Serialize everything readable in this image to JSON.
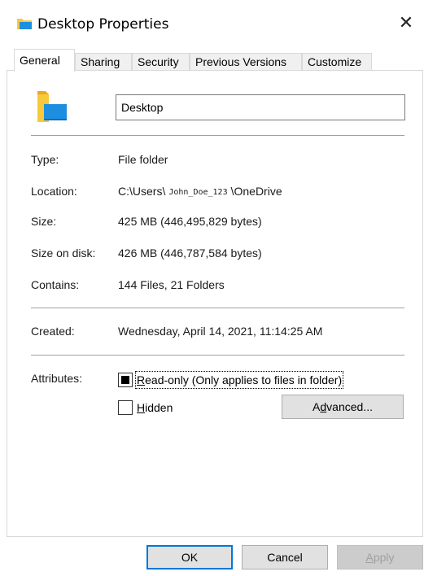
{
  "window": {
    "title": "Desktop Properties",
    "close_glyph": "✕"
  },
  "tabs": [
    {
      "label": "General",
      "active": true
    },
    {
      "label": "Sharing",
      "active": false
    },
    {
      "label": "Security",
      "active": false
    },
    {
      "label": "Previous Versions",
      "active": false
    },
    {
      "label": "Customize",
      "active": false
    }
  ],
  "general": {
    "folder_name": "Desktop",
    "type_label": "Type:",
    "type_value": "File folder",
    "location_label": "Location:",
    "location_prefix": "C:\\Users\\",
    "location_user": "John_Doe_123",
    "location_suffix": "\\OneDrive",
    "size_label": "Size:",
    "size_value": "425 MB (446,495,829 bytes)",
    "size_on_disk_label": "Size on disk:",
    "size_on_disk_value": "426 MB (446,787,584 bytes)",
    "contains_label": "Contains:",
    "contains_value": "144 Files, 21 Folders",
    "created_label": "Created:",
    "created_value": "Wednesday, April 14, 2021, 11:14:25 AM",
    "attributes_label": "Attributes:",
    "readonly_label_first": "R",
    "readonly_label_rest": "ead-only (Only applies to files in folder)",
    "readonly_state": "indeterminate",
    "hidden_label_first": "H",
    "hidden_label_rest": "idden",
    "hidden_state": "unchecked",
    "advanced_pre": "A",
    "advanced_u": "d",
    "advanced_post": "vanced..."
  },
  "footer": {
    "ok_label": "OK",
    "cancel_label": "Cancel",
    "apply_first": "A",
    "apply_rest": "pply"
  },
  "colors": {
    "accent": "#0078d7",
    "folder_yellow": "#f8c93a",
    "folder_blue": "#1e8fe0"
  }
}
